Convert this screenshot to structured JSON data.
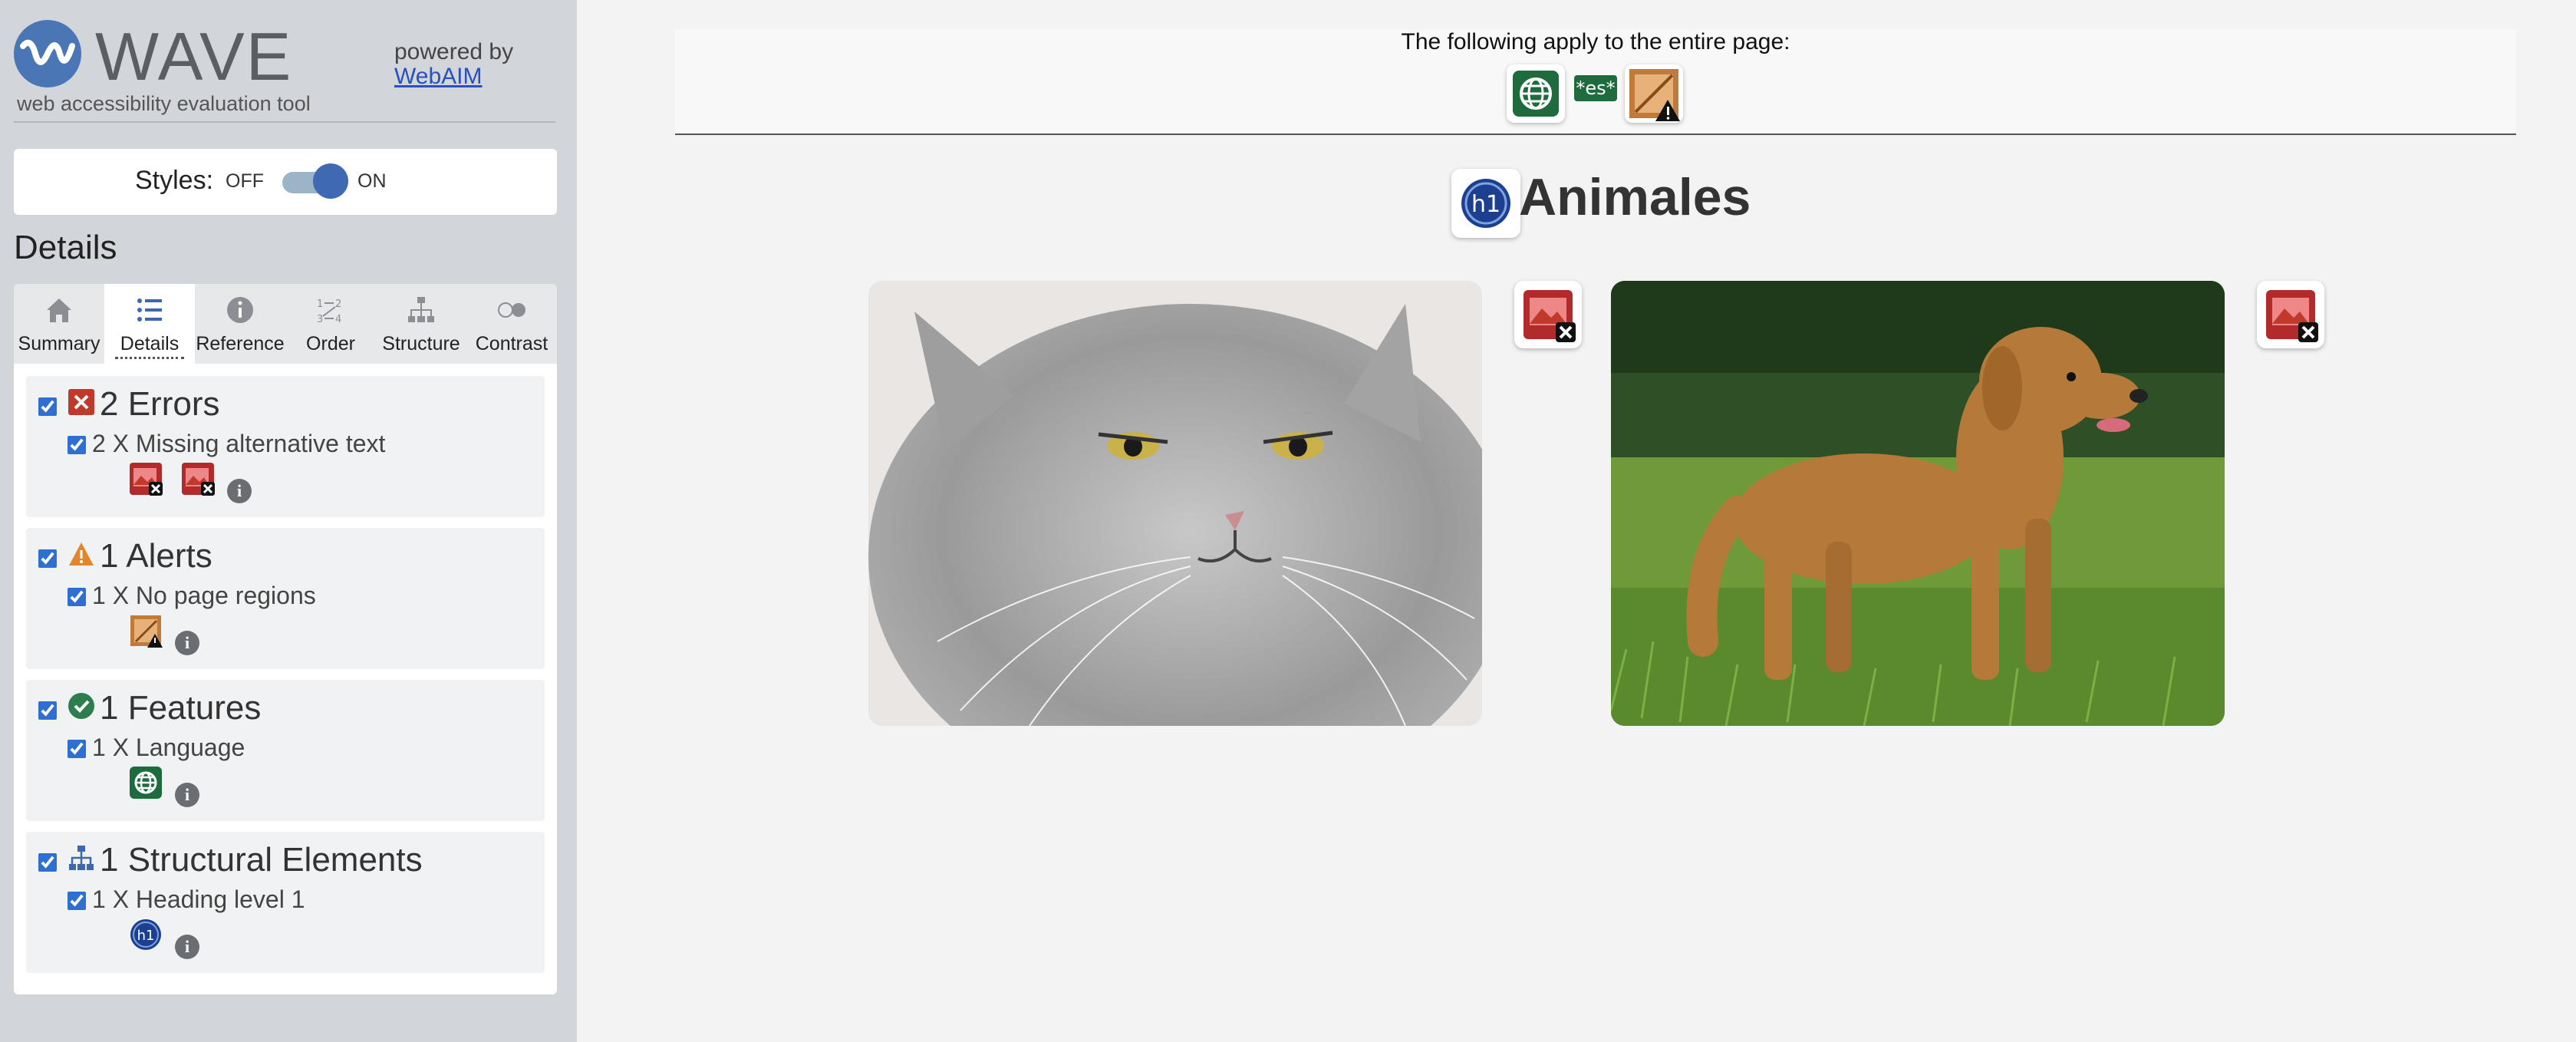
{
  "brand": {
    "name": "WAVE",
    "subtitle": "web accessibility evaluation tool",
    "powered_by": "powered by",
    "powered_link": "WebAIM"
  },
  "styles_toggle": {
    "label": "Styles:",
    "off": "OFF",
    "on": "ON",
    "state": "on"
  },
  "details_heading": "Details",
  "tabs": [
    {
      "label": "Summary",
      "icon": "home-icon"
    },
    {
      "label": "Details",
      "icon": "list-icon",
      "active": true
    },
    {
      "label": "Reference",
      "icon": "info-icon"
    },
    {
      "label": "Order",
      "icon": "order-icon"
    },
    {
      "label": "Structure",
      "icon": "structure-icon"
    },
    {
      "label": "Contrast",
      "icon": "contrast-icon"
    }
  ],
  "groups": {
    "errors": {
      "title": "2 Errors",
      "item": "2 X Missing alternative text",
      "icon": "error-x-icon",
      "color": "#c0392b"
    },
    "alerts": {
      "title": "1 Alerts",
      "item": "1 X No page regions",
      "icon": "alert-triangle-icon",
      "color": "#e2862d"
    },
    "features": {
      "title": "1 Features",
      "item": "1 X Language",
      "icon": "check-circle-icon",
      "color": "#2e7d4f"
    },
    "structural": {
      "title": "1 Structural Elements",
      "item": "1 X Heading level 1",
      "icon": "hierarchy-icon",
      "color": "#3d68b0"
    }
  },
  "page_bar": {
    "text": "The following apply to the entire page:",
    "lang_code": "*es*"
  },
  "h1_badge": "h1",
  "heading": "Animales",
  "photos": [
    {
      "subject": "grey-cat-photo"
    },
    {
      "subject": "golden-retriever-photo"
    }
  ]
}
